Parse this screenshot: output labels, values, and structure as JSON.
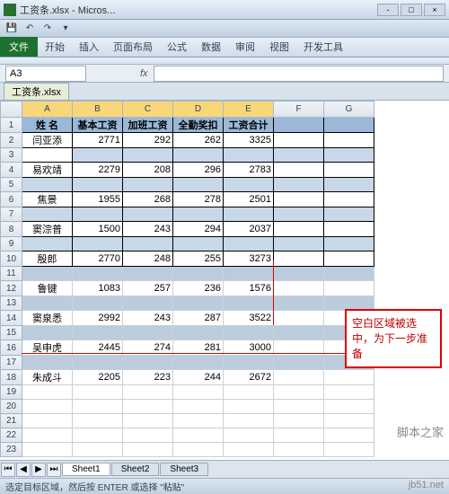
{
  "window": {
    "title": "工资条.xlsx - Micros..."
  },
  "ribbon": {
    "file": "文件",
    "tabs": [
      "开始",
      "插入",
      "页面布局",
      "公式",
      "数据",
      "审阅",
      "视图",
      "开发工具"
    ]
  },
  "namebox": "A3",
  "fx": "fx",
  "wbtab": "工资条.xlsx",
  "cols": [
    "",
    "A",
    "B",
    "C",
    "D",
    "E",
    "F",
    "G"
  ],
  "selcols": [
    "A",
    "B",
    "C",
    "D",
    "E"
  ],
  "headers": [
    "姓 名",
    "基本工资",
    "加班工资",
    "全勤奖扣",
    "工资合计"
  ],
  "rows": [
    {
      "r": 2,
      "t": "data",
      "c": [
        "闫亚添",
        "2771",
        "292",
        "262",
        "3325"
      ]
    },
    {
      "r": 3,
      "t": "sel",
      "active": true,
      "c": [
        "",
        "",
        "",
        "",
        ""
      ]
    },
    {
      "r": 4,
      "t": "data",
      "c": [
        "易欢靖",
        "2279",
        "208",
        "296",
        "2783"
      ]
    },
    {
      "r": 5,
      "t": "sel",
      "c": [
        "",
        "",
        "",
        "",
        ""
      ]
    },
    {
      "r": 6,
      "t": "data",
      "c": [
        "焦景",
        "1955",
        "268",
        "278",
        "2501"
      ]
    },
    {
      "r": 7,
      "t": "sel",
      "c": [
        "",
        "",
        "",
        "",
        ""
      ]
    },
    {
      "r": 8,
      "t": "data",
      "c": [
        "窦淙普",
        "1500",
        "243",
        "294",
        "2037"
      ]
    },
    {
      "r": 9,
      "t": "sel",
      "c": [
        "",
        "",
        "",
        "",
        ""
      ]
    },
    {
      "r": 10,
      "t": "data",
      "c": [
        "殷郎",
        "2770",
        "248",
        "255",
        "3273"
      ]
    },
    {
      "r": 11,
      "t": "shade",
      "c": [
        "",
        "",
        "",
        "",
        ""
      ]
    },
    {
      "r": 12,
      "t": "plain",
      "c": [
        "鲁键",
        "1083",
        "257",
        "236",
        "1576"
      ]
    },
    {
      "r": 13,
      "t": "shade",
      "c": [
        "",
        "",
        "",
        "",
        ""
      ]
    },
    {
      "r": 14,
      "t": "plain",
      "c": [
        "窦泉悉",
        "2992",
        "243",
        "287",
        "3522"
      ]
    },
    {
      "r": 15,
      "t": "shade",
      "c": [
        "",
        "",
        "",
        "",
        ""
      ]
    },
    {
      "r": 16,
      "t": "plain",
      "c": [
        "吴申虎",
        "2445",
        "274",
        "281",
        "3000"
      ]
    },
    {
      "r": 17,
      "t": "shade",
      "c": [
        "",
        "",
        "",
        "",
        ""
      ]
    },
    {
      "r": 18,
      "t": "plain",
      "c": [
        "朱成斗",
        "2205",
        "223",
        "244",
        "2672"
      ]
    }
  ],
  "emptyrows": [
    19,
    20,
    21,
    22,
    23
  ],
  "annotation": "空白区域被选中，为下一步准备",
  "sheets": [
    "Sheet1",
    "Sheet2",
    "Sheet3"
  ],
  "status": "选定目标区域，然后按 ENTER 或选择 \"粘贴\"",
  "watermark": "脚本之家",
  "footer": "jb51.net"
}
